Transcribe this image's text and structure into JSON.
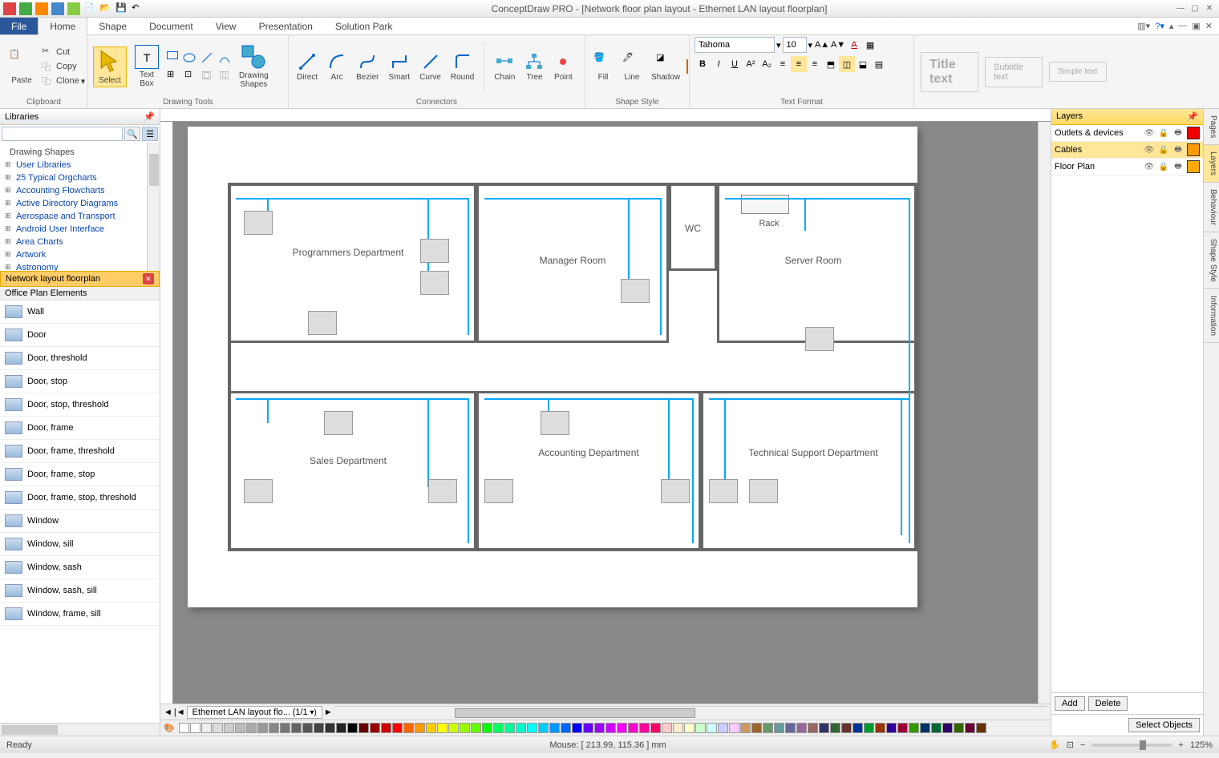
{
  "title": "ConceptDraw PRO - [Network floor plan layout - Ethernet LAN layout floorplan]",
  "menu": {
    "file": "File",
    "tabs": [
      "Home",
      "Shape",
      "Document",
      "View",
      "Presentation",
      "Solution Park"
    ],
    "active": "Home"
  },
  "ribbon": {
    "clipboard": {
      "label": "Clipboard",
      "paste": "Paste",
      "cut": "Cut",
      "copy": "Copy",
      "clone": "Clone"
    },
    "select": "Select",
    "textbox": "Text\nBox",
    "drawing": {
      "label": "Drawing Tools",
      "shapes": "Drawing\nShapes"
    },
    "connectors": {
      "label": "Connectors",
      "direct": "Direct",
      "arc": "Arc",
      "bezier": "Bezier",
      "smart": "Smart",
      "curve": "Curve",
      "round": "Round",
      "chain": "Chain",
      "tree": "Tree",
      "point": "Point"
    },
    "shapestyle": {
      "label": "Shape Style",
      "fill": "Fill",
      "line": "Line",
      "shadow": "Shadow"
    },
    "textformat": {
      "label": "Text Format",
      "font": "Tahoma",
      "size": "10"
    },
    "presets": {
      "title": "Title text",
      "subtitle": "Subtitle text",
      "simple": "Simple text"
    }
  },
  "libraries": {
    "title": "Libraries",
    "tree_head": "Drawing Shapes",
    "tree": [
      "User Libraries",
      "25 Typical Orgcharts",
      "Accounting Flowcharts",
      "Active Directory Diagrams",
      "Aerospace and Transport",
      "Android User Interface",
      "Area Charts",
      "Artwork",
      "Astronomy"
    ],
    "section": "Network layout floorplan",
    "subhead": "Office Plan Elements",
    "items": [
      "Wall",
      "Door",
      "Door, threshold",
      "Door, stop",
      "Door, stop, threshold",
      "Door, frame",
      "Door, frame, threshold",
      "Door, frame, stop",
      "Door, frame, stop, threshold",
      "Window",
      "Window, sill",
      "Window, sash",
      "Window, sash, sill",
      "Window, frame, sill"
    ]
  },
  "layers": {
    "title": "Layers",
    "rows": [
      {
        "name": "Outlets & devices",
        "color": "#e00"
      },
      {
        "name": "Cables",
        "color": "#f90",
        "selected": true
      },
      {
        "name": "Floor Plan",
        "color": "#fa0"
      }
    ],
    "add": "Add",
    "delete": "Delete",
    "select": "Select Objects"
  },
  "sidetabs": [
    "Pages",
    "Layers",
    "Behaviour",
    "Shape Style",
    "Information"
  ],
  "canvas": {
    "rooms": [
      "Programmers Department",
      "Manager Room",
      "WC",
      "Server Room",
      "Sales Department",
      "Accounting Department",
      "Technical Support Department"
    ],
    "rack": "Rack",
    "page_tab": "Ethernet LAN layout flo...",
    "page_num": "(1/1"
  },
  "status": {
    "ready": "Ready",
    "mouse": "Mouse: [ 213.99, 115.36 ] mm",
    "zoom": "125%"
  }
}
